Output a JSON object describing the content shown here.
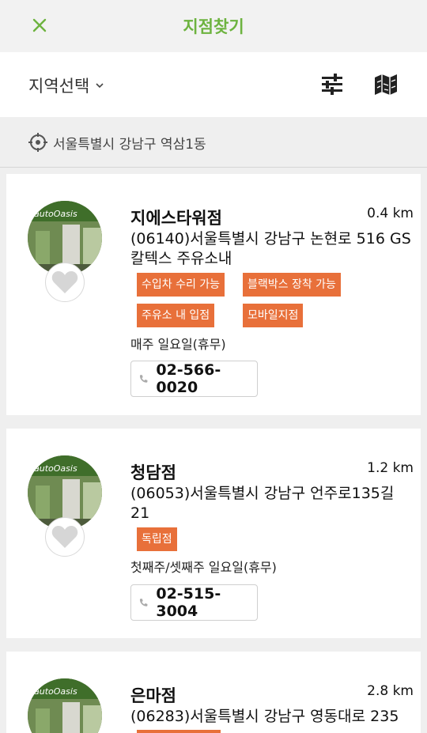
{
  "header": {
    "title": "지점찾기",
    "accent": "#6db33f"
  },
  "filter": {
    "region_label": "지역선택"
  },
  "location": {
    "current": "서울특별시 강남구 역삼1동"
  },
  "branches": [
    {
      "name": "지에스타워점",
      "distance": "0.4 km",
      "address": "(06140)서울특별시 강남구 논현로 516 GS칼텍스 주유소내",
      "tags": [
        "수입차 수리 가능",
        "블랙박스 장착 가능",
        "주유소 내 입점",
        "모바일지점"
      ],
      "hours": "매주 일요일(휴무)",
      "phone": "02-566-0020"
    },
    {
      "name": "청담점",
      "distance": "1.2 km",
      "address": "(06053)서울특별시 강남구 언주로135길 21",
      "tags": [
        "독립점"
      ],
      "hours": "첫째주/셋째주 일요일(휴무)",
      "phone": "02-515-3004"
    },
    {
      "name": "은마점",
      "distance": "2.8 km",
      "address": "(06283)서울특별시 강남구 영동대로 235"
    }
  ],
  "colors": {
    "tag": "#e8703a",
    "background": "#efefef"
  },
  "icons": {
    "close": "close-icon",
    "chevron": "chevron-down-icon",
    "filter": "sliders-icon",
    "map": "map-icon",
    "location": "crosshair-icon",
    "favorite": "heart-icon",
    "phone": "phone-icon"
  }
}
